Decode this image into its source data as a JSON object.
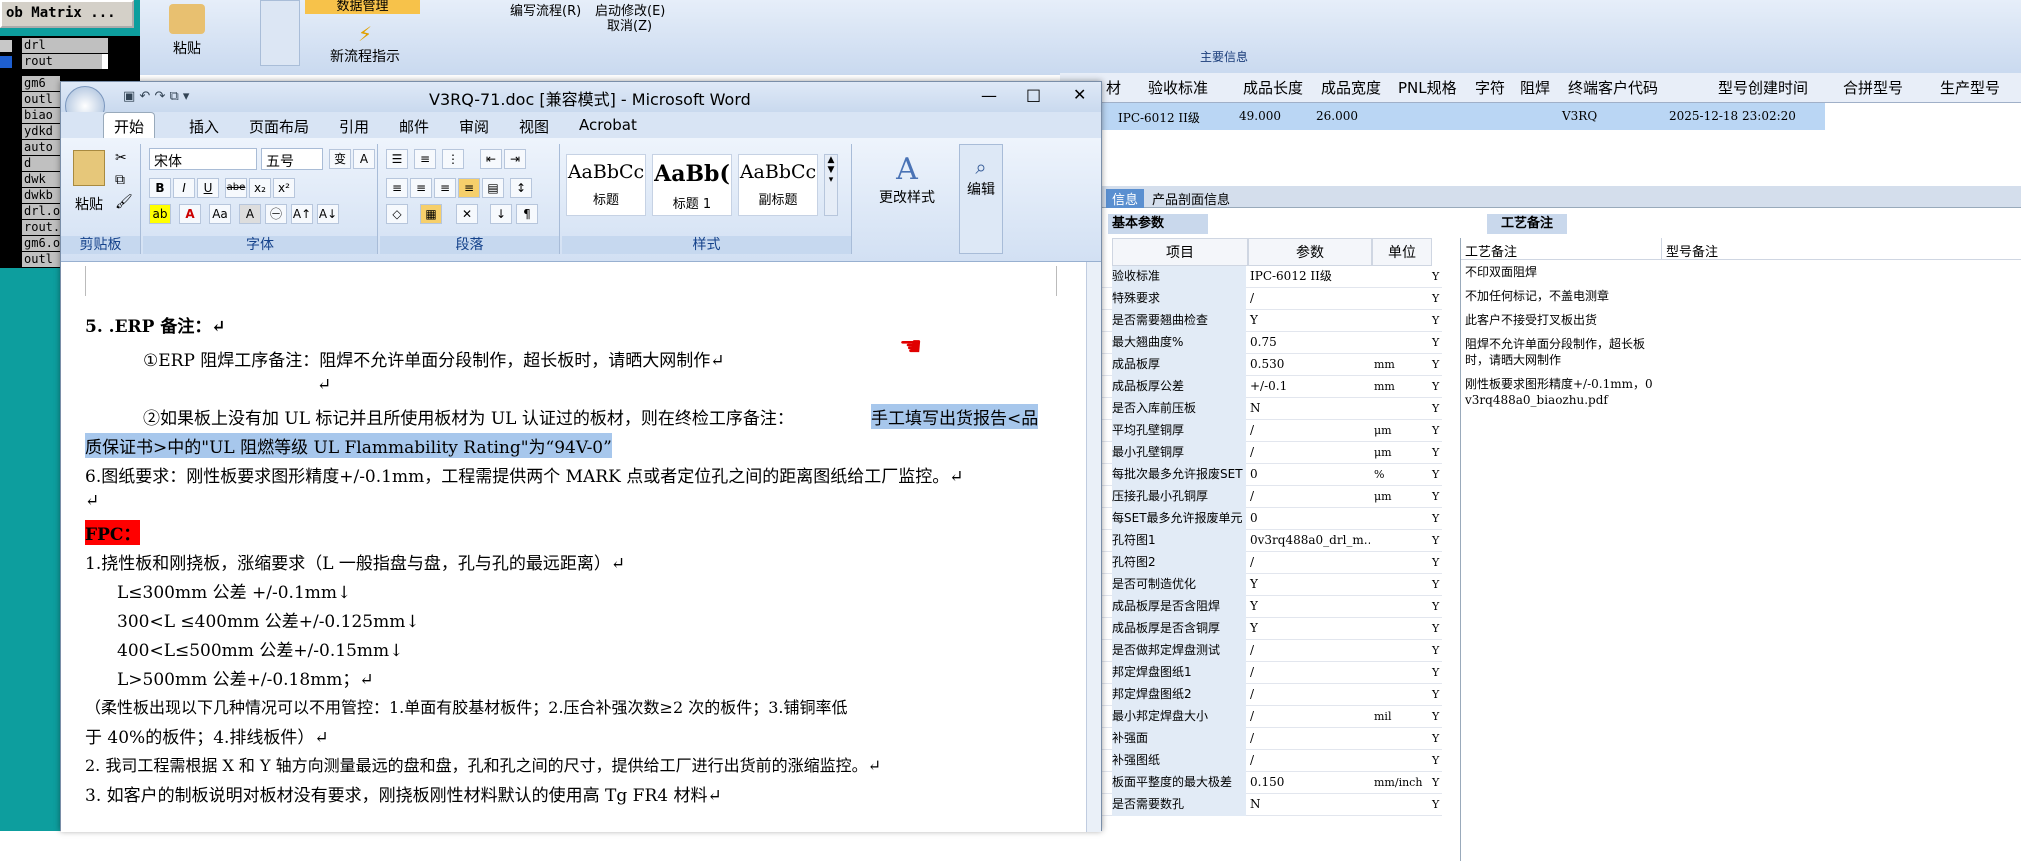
{
  "left_panel": {
    "title": "ob Matrix ...",
    "rows": [
      {
        "name": "drl",
        "selected": false
      },
      {
        "name": "rout",
        "selected": true
      }
    ],
    "layers": [
      "gm6",
      "outl",
      "biao",
      "ydkd",
      "auto",
      "d",
      "dwk",
      "dwkb",
      "drl.o",
      "rout.",
      "gm6.o",
      "outl"
    ]
  },
  "app_ribbon": {
    "paste": "粘贴",
    "data_manage": "数据管理",
    "new_flow": "新流程指示",
    "edit_flow": "编写流程(R)",
    "start_modify": "启动修改(E)",
    "cancel": "取消(Z)",
    "main_info": "主要信息"
  },
  "grid": {
    "headers": [
      "材",
      "验收标准",
      "成品长度",
      "成品宽度",
      "PNL规格",
      "字符",
      "阻焊",
      "终端客户代码",
      "型号创建时间",
      "合拼型号",
      "生产型号"
    ],
    "row": {
      "acceptance": "IPC-6012 II级",
      "length": "49.000",
      "width": "26.000",
      "customer": "V3RQ",
      "created": "2025-12-18 23:02:20"
    }
  },
  "word": {
    "title": "V3RQ-71.doc [兼容模式] - Microsoft Word",
    "tabs": [
      "开始",
      "插入",
      "页面布局",
      "引用",
      "邮件",
      "审阅",
      "视图",
      "Acrobat"
    ],
    "font_name": "宋体",
    "font_size": "五号",
    "groups": {
      "clipboard": "剪贴板",
      "font": "字体",
      "paragraph": "段落",
      "styles": "样式"
    },
    "paste_label": "粘贴",
    "styles": [
      {
        "sample": "AaBbCc",
        "label": "标题"
      },
      {
        "sample": "AaBb(",
        "label": "标题 1"
      },
      {
        "sample": "AaBbCc",
        "label": "副标题"
      }
    ],
    "change_styles": "更改样式",
    "edit": "编辑",
    "lines": [
      "5. .ERP 备注：↵",
      "①ERP 阻焊工序备注：阻焊不允许单面分段制作，超长板时，请晒大网制作↵",
      "↵",
      "②如果板上没有加 UL 标记并且所使用板材为 UL 认证过的板材，则在终检工序备注：",
      "手工填写出货报告<品",
      "质保证书>中的\"UL 阻燃等级 UL Flammability Rating\"为“94V-0”",
      "6.图纸要求：刚性板要求图形精度+/-0.1mm，工程需提供两个 MARK 点或者定位孔之间的距离图纸给工厂监控。↵",
      "↵",
      "FPC：",
      "1.挠性板和刚挠板，涨缩要求（L 一般指盘与盘，孔与孔的最远距离）↵",
      "L≤300mm 公差 +/-0.1mm↓",
      "300<L ≤400mm 公差+/-0.125mm↓",
      "400<L≤500mm 公差+/-0.15mm↓",
      "L>500mm 公差+/-0.18mm；↵",
      "（柔性板出现以下几种情况可以不用管控：1.单面有胶基材板件；2.压合补强次数≥2 次的板件；3.铺铜率低",
      "于 40%的板件；4.排线板件）↵",
      "2.    我司工程需根据 X 和 Y 轴方向测量最远的盘和盘，孔和孔之间的尺寸，提供给工厂进行出货前的涨缩监控。↵",
      "3. 如客户的制板说明对板材没有要求，刚挠板刚性材料默认的使用高 Tg FR4 材料↵"
    ]
  },
  "right_panel": {
    "tabs": [
      "信息",
      "产品剖面信息"
    ],
    "basic": "基本参数",
    "craft_tab": "工艺备注",
    "headers": [
      "项目",
      "参数",
      "单位"
    ],
    "notes_headers": [
      "工艺备注",
      "型号备注"
    ],
    "params": [
      [
        "验收标准",
        "IPC-6012 II级",
        "",
        "Y"
      ],
      [
        "特殊要求",
        "/",
        "",
        "Y"
      ],
      [
        "是否需要翘曲检查",
        "Y",
        "",
        "Y"
      ],
      [
        "最大翘曲度%",
        "0.75",
        "",
        "Y"
      ],
      [
        "成品板厚",
        "0.530",
        "mm",
        "Y"
      ],
      [
        "成品板厚公差",
        "+/-0.1",
        "mm",
        "Y"
      ],
      [
        "是否入库前压板",
        "N",
        "",
        "Y"
      ],
      [
        "平均孔壁铜厚",
        "/",
        "μm",
        "Y"
      ],
      [
        "最小孔壁铜厚",
        "/",
        "μm",
        "Y"
      ],
      [
        "每批次最多允许报废SET",
        "0",
        "%",
        "Y"
      ],
      [
        "压接孔最小孔铜厚",
        "/",
        "μm",
        "Y"
      ],
      [
        "每SET最多允许报废单元",
        "0",
        "",
        "Y"
      ],
      [
        "孔符图1",
        "0v3rq488a0_drl_m...",
        "",
        "Y"
      ],
      [
        "孔符图2",
        "/",
        "",
        "Y"
      ],
      [
        "是否可制造优化",
        "Y",
        "",
        "Y"
      ],
      [
        "成品板厚是否含阻焊",
        "Y",
        "",
        "Y"
      ],
      [
        "成品板厚是否含铜厚",
        "Y",
        "",
        "Y"
      ],
      [
        "是否做邦定焊盘测试",
        "/",
        "",
        "Y"
      ],
      [
        "邦定焊盘图纸1",
        "/",
        "",
        "Y"
      ],
      [
        "邦定焊盘图纸2",
        "/",
        "",
        "Y"
      ],
      [
        "最小邦定焊盘大小",
        "/",
        "mil",
        "Y"
      ],
      [
        "补强面",
        "/",
        "",
        "Y"
      ],
      [
        "补强图纸",
        "/",
        "",
        "Y"
      ],
      [
        "板面平整度的最大极差",
        "0.150",
        "mm/inch",
        "Y"
      ],
      [
        "是否需要数孔",
        "N",
        "",
        "Y"
      ]
    ],
    "notes": [
      "不印双面阻焊",
      "不加任何标记，不盖电测章",
      "此客户不接受打叉板出货",
      "阻焊不允许单面分段制作，超长板时，请晒大网制作",
      "刚性板要求图形精度+/-0.1mm，0v3rq488a0_biaozhu.pdf"
    ]
  },
  "colors": {
    "teal": "#0d9e9e",
    "selection": "#a7c7ec",
    "fpc_red": "#ff0000"
  }
}
